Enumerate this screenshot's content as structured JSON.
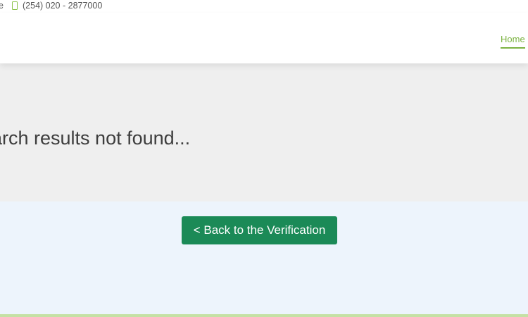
{
  "topbar": {
    "cut_text": "e",
    "phone": "(254) 020 - 2877000",
    "phone_icon": "mobile-phone-icon"
  },
  "nav": {
    "home": "Home"
  },
  "hero": {
    "title": "arch results not found..."
  },
  "main": {
    "back_button": "< Back to the Verification"
  },
  "colors": {
    "accent_green": "#7cb342",
    "button_green": "#1b8a57",
    "hero_bg": "#efefef",
    "lower_bg": "#edf4fc"
  }
}
